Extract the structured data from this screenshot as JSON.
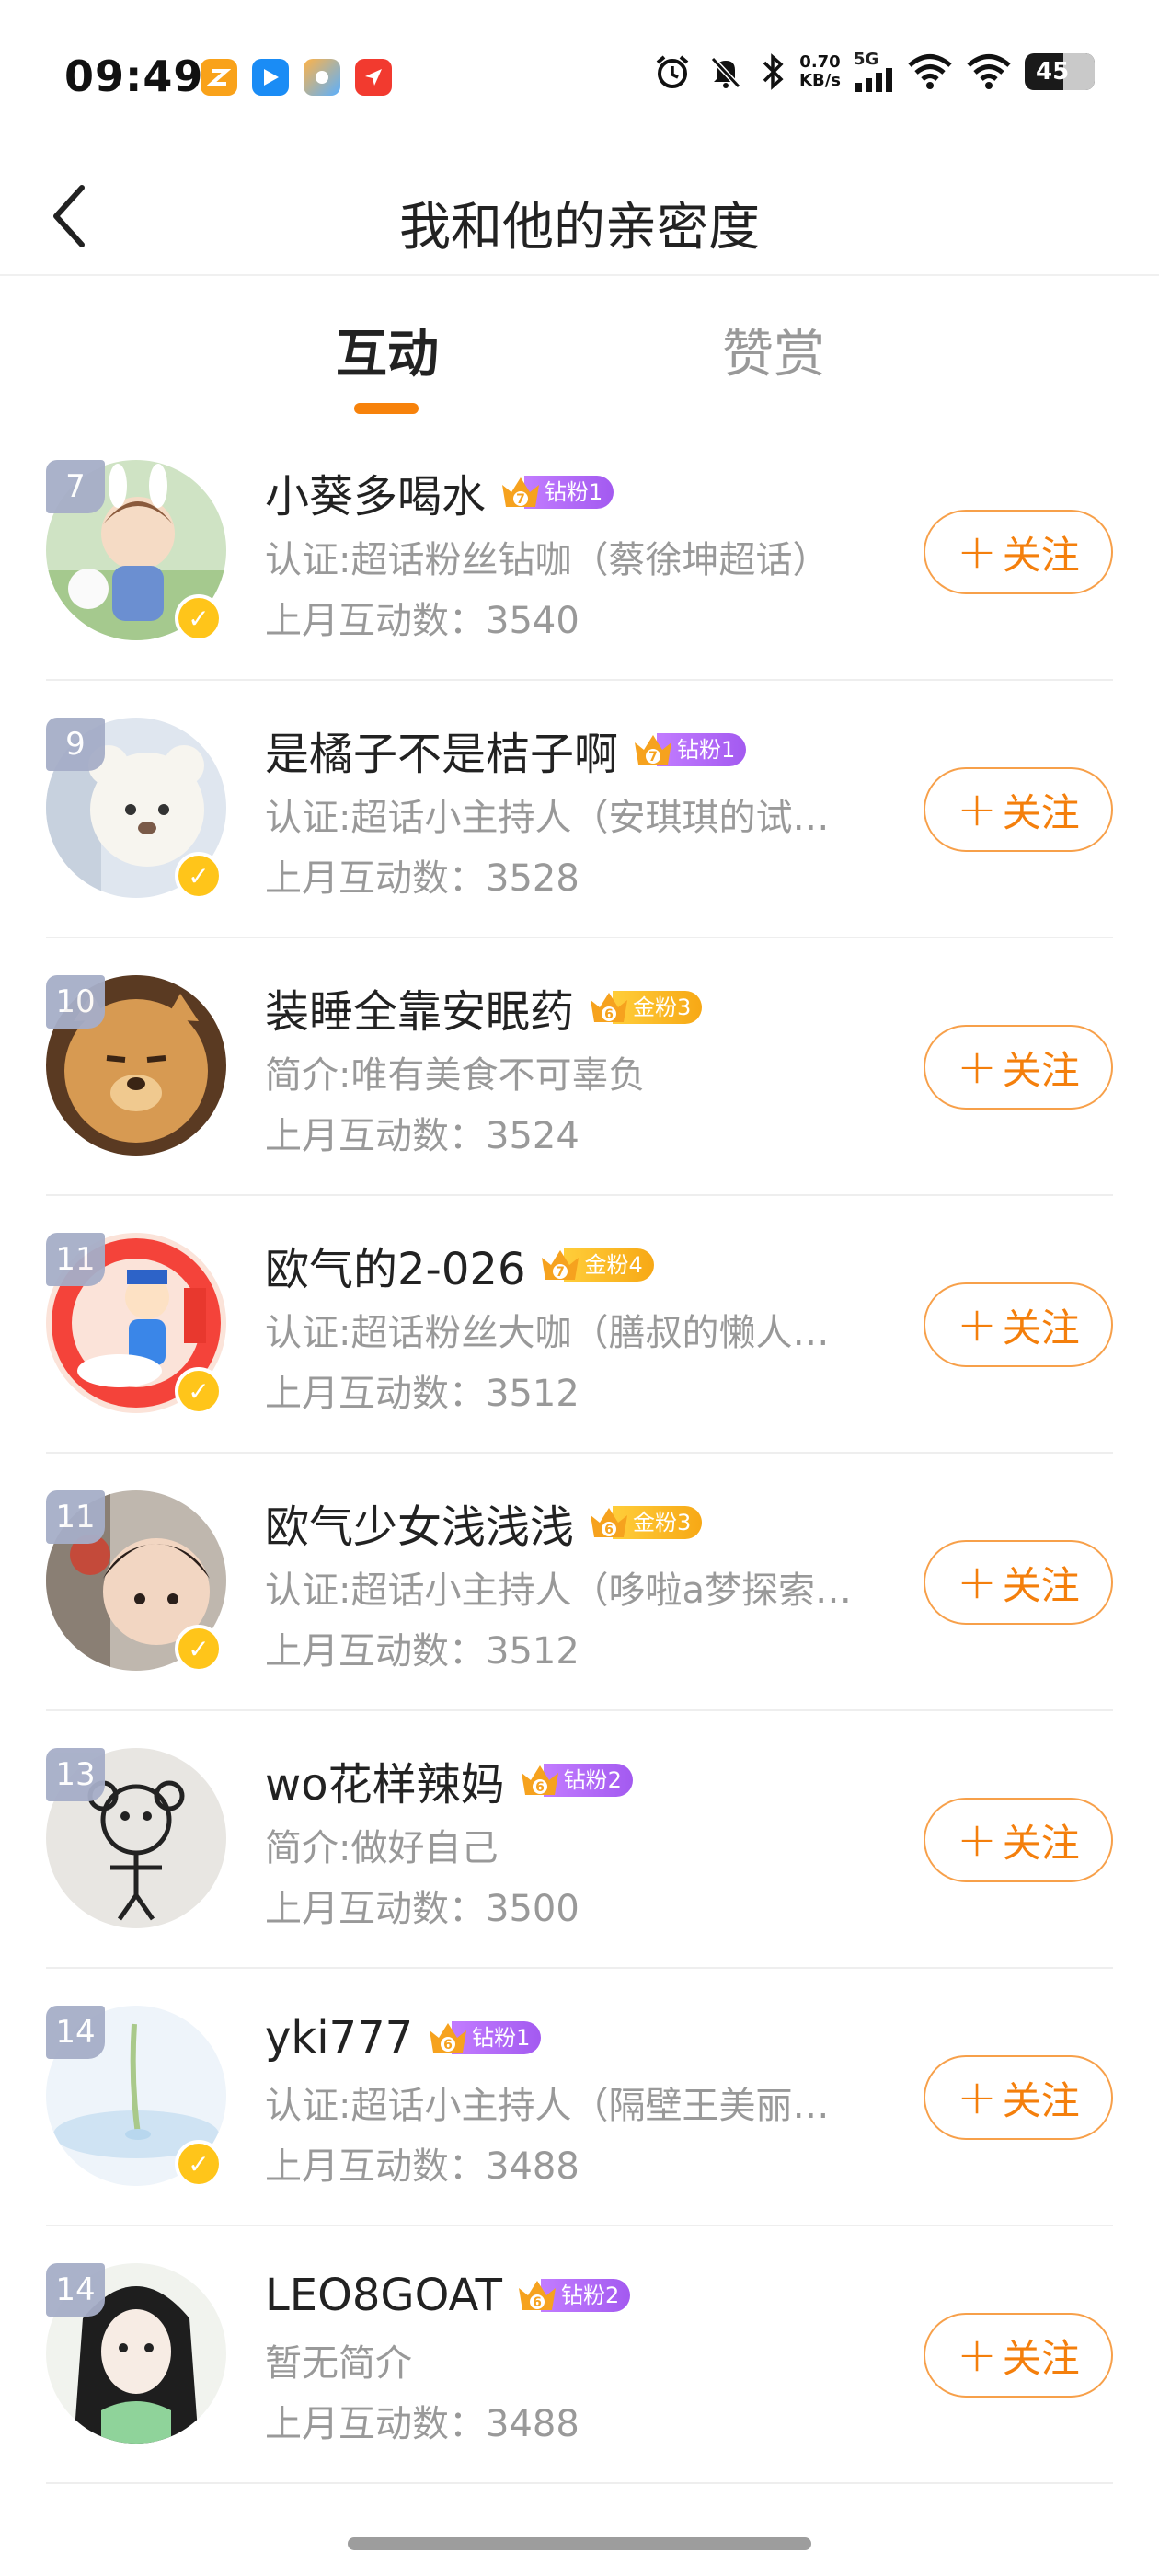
{
  "status_bar": {
    "time": "09:49",
    "net_speed_value": "0.70",
    "net_speed_unit": "KB/s",
    "network_type": "5G",
    "battery": "45",
    "app_icons": [
      "orange-app-icon",
      "blue-app-icon",
      "gradient-app-icon",
      "red-app-icon"
    ]
  },
  "header": {
    "title": "我和他的亲密度"
  },
  "tabs": [
    {
      "label": "互动",
      "active": true
    },
    {
      "label": "赞赏",
      "active": false
    }
  ],
  "colors": {
    "accent": "#f7820b",
    "follow_text": "#f47f0c",
    "diamond_badge": "#b06cf5",
    "gold_badge": "#f9b825",
    "rank_badge": "#a6aec8"
  },
  "follow_label": "关注",
  "users": [
    {
      "rank": "7",
      "name": "小葵多喝水",
      "badge_level": "7",
      "badge_type": "diamond",
      "badge_label": "钻粉1",
      "desc": "认证:超话粉丝钻咖（蔡徐坤超话）",
      "interactions": "上月互动数：3540",
      "verified": true
    },
    {
      "rank": "9",
      "name": "是橘子不是桔子啊",
      "badge_level": "7",
      "badge_type": "diamond",
      "badge_label": "钻粉1",
      "desc": "认证:超话小主持人（安琪琪的试…",
      "interactions": "上月互动数：3528",
      "verified": true
    },
    {
      "rank": "10",
      "name": "装睡全靠安眠药",
      "badge_level": "6",
      "badge_type": "gold",
      "badge_label": "金粉3",
      "desc": "简介:唯有美食不可辜负",
      "interactions": "上月互动数：3524",
      "verified": false
    },
    {
      "rank": "11",
      "name": "欧气的2-026",
      "badge_level": "7",
      "badge_type": "gold",
      "badge_label": "金粉4",
      "desc": "认证:超话粉丝大咖（膳叔的懒人…",
      "interactions": "上月互动数：3512",
      "verified": true
    },
    {
      "rank": "11",
      "name": "欧气少女浅浅浅",
      "badge_level": "6",
      "badge_type": "gold",
      "badge_label": "金粉3",
      "desc": "认证:超话小主持人（哆啦a梦探索…",
      "interactions": "上月互动数：3512",
      "verified": true
    },
    {
      "rank": "13",
      "name": "wo花样辣妈",
      "badge_level": "6",
      "badge_type": "diamond",
      "badge_label": "钻粉2",
      "desc": "简介:做好自己",
      "interactions": "上月互动数：3500",
      "verified": false
    },
    {
      "rank": "14",
      "name": "yki777",
      "badge_level": "6",
      "badge_type": "diamond",
      "badge_label": "钻粉1",
      "desc": "认证:超话小主持人（隔壁王美丽…",
      "interactions": "上月互动数：3488",
      "verified": true
    },
    {
      "rank": "14",
      "name": "LEO8GOAT",
      "badge_level": "6",
      "badge_type": "diamond",
      "badge_label": "钻粉2",
      "desc": "暂无简介",
      "interactions": "上月互动数：3488",
      "verified": false
    }
  ]
}
